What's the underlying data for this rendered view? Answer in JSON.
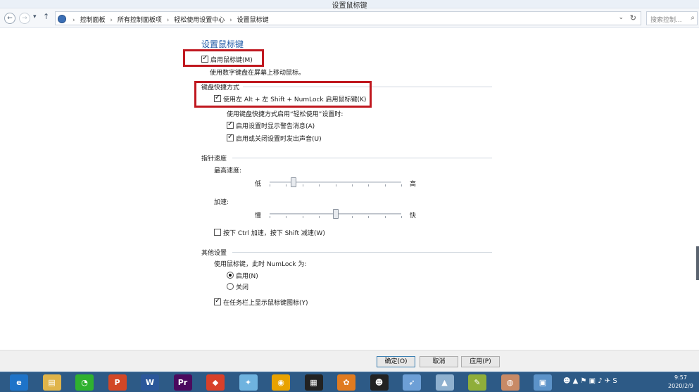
{
  "window": {
    "title": "设置鼠标键"
  },
  "nav": {
    "breadcrumbs": [
      "控制面板",
      "所有控制面板项",
      "轻松使用设置中心",
      "设置鼠标键"
    ],
    "search_placeholder": "搜索控制..."
  },
  "page": {
    "heading": "设置鼠标键",
    "enable_mousekeys": {
      "label": "启用鼠标键(M)",
      "checked": true
    },
    "enable_desc": "使用数字键盘在屏幕上移动鼠标。",
    "keyboard_shortcut": {
      "group_label": "键盘快捷方式",
      "shortcut_toggle": {
        "label": "使用左 Alt + 左 Shift + NumLock 启用鼠标键(K)",
        "checked": true
      },
      "sub_label": "使用键盘快捷方式启用“轻松使用”设置时:",
      "warning": {
        "label": "启用设置时显示警告消息(A)",
        "checked": true
      },
      "sound": {
        "label": "启用或关闭设置时发出声音(U)",
        "checked": true
      }
    },
    "pointer_speed": {
      "group_label": "指针速度",
      "top_speed": {
        "label": "最高速度:",
        "low": "低",
        "high": "高",
        "value": 0.18
      },
      "acceleration": {
        "label": "加速:",
        "low": "慢",
        "high": "快",
        "value": 0.5
      },
      "ctrl_shift": {
        "label": "按下 Ctrl 加速，按下 Shift 减速(W)",
        "checked": false
      }
    },
    "other": {
      "group_label": "其他设置",
      "numlock_label": "使用鼠标键，此时 NumLock 为:",
      "on": {
        "label": "启用(N)",
        "selected": true
      },
      "off": {
        "label": "关闭",
        "selected": false
      },
      "taskbar_icon": {
        "label": "在任务栏上显示鼠标键图标(Y)",
        "checked": true
      }
    }
  },
  "buttons": {
    "ok": "确定(O)",
    "cancel": "取消",
    "apply": "应用(P)"
  },
  "taskbar": {
    "apps": [
      {
        "name": "ie",
        "glyph": "e",
        "color": "#1e73c8"
      },
      {
        "name": "explorer",
        "glyph": "▤",
        "color": "#e0b44a"
      },
      {
        "name": "wechat",
        "glyph": "◔",
        "color": "#2fb12f"
      },
      {
        "name": "powerpoint",
        "glyph": "P",
        "color": "#d24726"
      },
      {
        "name": "word",
        "glyph": "W",
        "color": "#2b579a"
      },
      {
        "name": "premiere",
        "glyph": "Pr",
        "color": "#4b0a5e"
      },
      {
        "name": "media-app",
        "glyph": "◆",
        "color": "#d8402a"
      },
      {
        "name": "bird-app",
        "glyph": "✦",
        "color": "#6fb3df"
      },
      {
        "name": "chrome",
        "glyph": "◉",
        "color": "#e8a200"
      },
      {
        "name": "video-editor",
        "glyph": "▦",
        "color": "#222222"
      },
      {
        "name": "photo-app",
        "glyph": "✿",
        "color": "#e07b20"
      },
      {
        "name": "qq",
        "glyph": "☻",
        "color": "#222222"
      },
      {
        "name": "feather-app",
        "glyph": "➶",
        "color": "#6d9fd6"
      },
      {
        "name": "tool-app",
        "glyph": "▲",
        "color": "#8fb1cf"
      },
      {
        "name": "notes-app",
        "glyph": "✎",
        "color": "#8fae3a"
      },
      {
        "name": "image-app",
        "glyph": "◍",
        "color": "#c88a66"
      },
      {
        "name": "mouse-keys-app",
        "glyph": "▣",
        "color": "#5c93c9"
      }
    ],
    "tray_glyphs": "☻ ▲ ⚑ ▣ ♪ ✈ S",
    "time": "9:57",
    "date": "2020/2/9"
  }
}
